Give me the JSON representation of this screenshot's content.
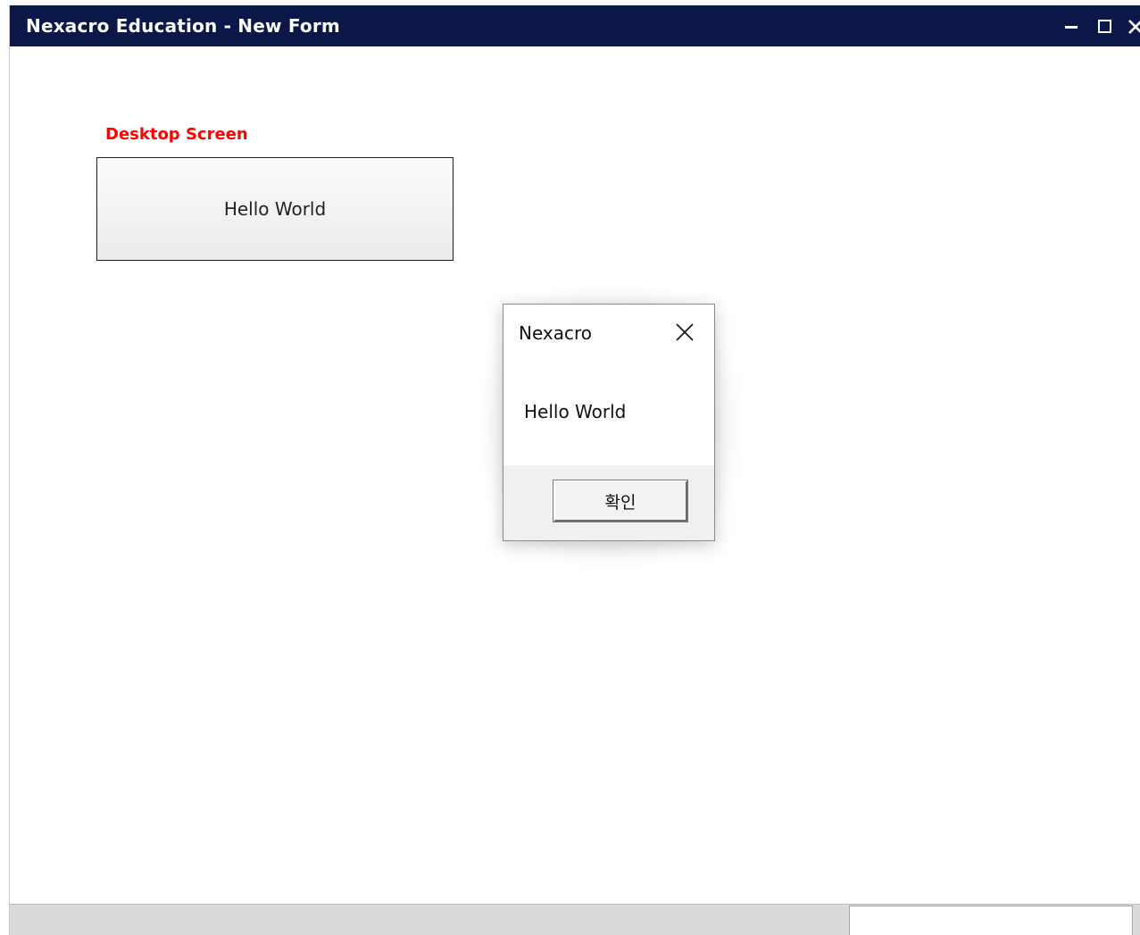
{
  "window": {
    "title": "Nexacro Education - New Form",
    "controls": {
      "minimize_icon": "minimize-icon",
      "maximize_icon": "maximize-icon",
      "close_icon": "close-icon"
    },
    "titlebar_color": "#0b1847"
  },
  "form": {
    "label_text": "Desktop Screen",
    "label_color": "#ff0000",
    "button_label": "Hello World"
  },
  "dialog": {
    "title": "Nexacro",
    "message": "Hello World",
    "ok_label": "확인",
    "close_icon": "close-icon"
  },
  "statusbar": {
    "field_value": ""
  }
}
